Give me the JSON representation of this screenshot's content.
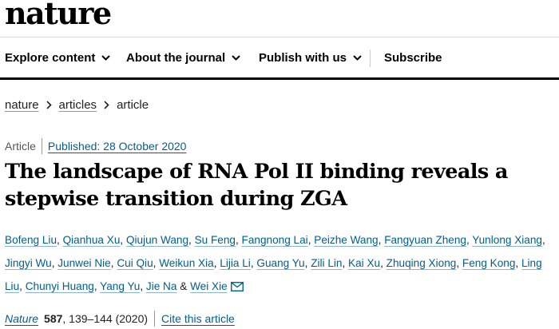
{
  "header": {
    "logo": "nature",
    "nav": [
      {
        "label": "Explore content",
        "has_dropdown": true
      },
      {
        "label": "About the journal",
        "has_dropdown": true
      },
      {
        "label": "Publish with us",
        "has_dropdown": true
      },
      {
        "label": "Subscribe",
        "has_dropdown": false
      }
    ]
  },
  "breadcrumb": {
    "items": [
      "nature",
      "articles"
    ],
    "current": "article"
  },
  "article": {
    "type": "Article",
    "published": "Published: 28 October 2020",
    "title": "The landscape of RNA Pol II binding reveals a stepwise transition during ZGA",
    "authors": [
      "Bofeng Liu",
      "Qianhua Xu",
      "Qiujun Wang",
      "Su Feng",
      "Fangnong Lai",
      "Peizhe Wang",
      "Fangyuan Zheng",
      "Yunlong Xiang",
      "Jingyi Wu",
      "Junwei Nie",
      "Cui Qiu",
      "Weikun Xia",
      "Lijia Li",
      "Guang Yu",
      "Zili Lin",
      "Kai Xu",
      "Zhuqing Xiong",
      "Feng Kong",
      "Ling Liu",
      "Chunyi Huang",
      "Yang Yu",
      "Jie Na",
      "Wei Xie"
    ],
    "author_separator": ",",
    "last_author_joiner": "&",
    "corresponding_icon": "mail-icon"
  },
  "citation": {
    "journal": "Nature",
    "volume": "587",
    "pages": ", 139–144 (2020)",
    "cite_link": "Cite this article"
  },
  "colors": {
    "link": "#025e8d",
    "text": "#222222",
    "nav_border": "#000000"
  }
}
